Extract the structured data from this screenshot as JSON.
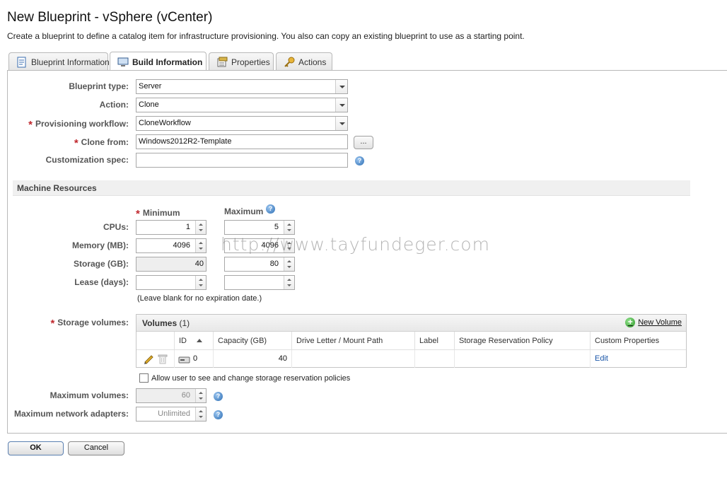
{
  "page": {
    "title": "New Blueprint - vSphere (vCenter)",
    "subtitle": "Create a blueprint to define a catalog item for infrastructure provisioning. You also can copy an existing blueprint to use as a starting point."
  },
  "tabs": [
    {
      "label": "Blueprint Information",
      "icon": "document-icon",
      "active": false
    },
    {
      "label": "Build Information",
      "icon": "monitor-icon",
      "active": true
    },
    {
      "label": "Properties",
      "icon": "properties-icon",
      "active": false
    },
    {
      "label": "Actions",
      "icon": "key-icon",
      "active": false
    }
  ],
  "build": {
    "blueprint_type": {
      "label": "Blueprint type:",
      "value": "Server"
    },
    "action": {
      "label": "Action:",
      "value": "Clone"
    },
    "provisioning_workflow": {
      "label": "Provisioning workflow:",
      "value": "CloneWorkflow",
      "required": true
    },
    "clone_from": {
      "label": "Clone from:",
      "value": "Windows2012R2-Template",
      "browse": "...",
      "required": true
    },
    "customization_spec": {
      "label": "Customization spec:",
      "value": ""
    }
  },
  "machine_resources": {
    "section_title": "Machine Resources",
    "minimum_label": "Minimum",
    "maximum_label": "Maximum",
    "rows": [
      {
        "label": "CPUs:",
        "min": "1",
        "max": "5"
      },
      {
        "label": "Memory (MB):",
        "min": "4096",
        "max": "4096"
      },
      {
        "label": "Storage (GB):",
        "min": "40",
        "max": "80"
      },
      {
        "label": "Lease (days):",
        "min": "",
        "max": ""
      }
    ],
    "lease_note": "(Leave blank for no expiration date.)"
  },
  "watermark": "http://www.tayfundeger.com",
  "storage": {
    "label": "Storage volumes:",
    "panel_title": "Volumes",
    "count": "(1)",
    "new_volume": "New Volume",
    "columns": [
      "ID",
      "Capacity (GB)",
      "Drive Letter / Mount Path",
      "Label",
      "Storage Reservation Policy",
      "Custom Properties"
    ],
    "rows": [
      {
        "id": "0",
        "capacity": "40",
        "drive": "",
        "label": "",
        "policy": "",
        "custom": "Edit"
      }
    ],
    "allow_label": "Allow user to see and change storage reservation policies",
    "allow_checked": false
  },
  "max_volumes": {
    "label": "Maximum volumes:",
    "value": "60"
  },
  "max_network": {
    "label": "Maximum network adapters:",
    "value": "Unlimited"
  },
  "help_glyph": "?",
  "buttons": {
    "ok": "OK",
    "cancel": "Cancel"
  },
  "colors": {
    "required": "#c0272d",
    "link": "#1a56a8",
    "accent": "#2b6db3"
  }
}
